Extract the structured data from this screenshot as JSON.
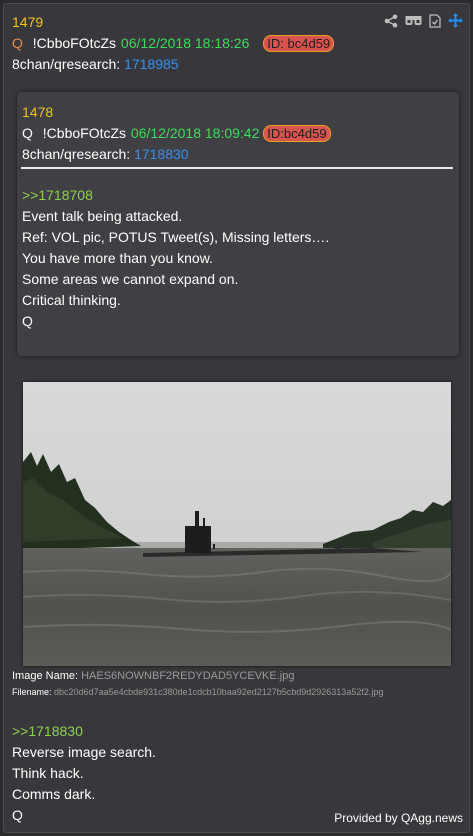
{
  "post": {
    "number": "1479",
    "author": "Q",
    "tripcode": "!CbboFOtcZs",
    "date": "06/12/2018 18:18:26",
    "id": "ID: bc4d59",
    "board": "8chan/qresearch:",
    "thread": "1718985"
  },
  "toolbar": {
    "icons": [
      "share-icon",
      "glasses-icon",
      "document-icon",
      "move-icon"
    ],
    "accent": "#1e90ff"
  },
  "quoted": {
    "number": "1478",
    "author": "Q",
    "tripcode": "!CbboFOtcZs",
    "date": "06/12/2018 18:09:42",
    "id": "ID:bc4d59",
    "board": "8chan/qresearch:",
    "thread": "1718830",
    "reply_link": ">>1718708",
    "lines": [
      "Event talk being attacked.",
      "Ref: VOL pic, POTUS Tweet(s), Missing letters….",
      "You have more than you know.",
      "Some areas we cannot expand on.",
      "Critical thinking.",
      "Q"
    ]
  },
  "image": {
    "name_label": "Image Name:",
    "name": "HAES6NOWNBF2REDYDAD5YCEVKE.jpg",
    "filename_label": "Filename:",
    "filename": "dbc20d6d7aa5e4cbde931c380de1cdcb10baa92ed2127b5cbd9d2926313a52f2.jpg"
  },
  "body": {
    "reply_link": ">>1718830",
    "lines": [
      "Reverse image search.",
      "Think hack.",
      "Comms dark.",
      "Q"
    ]
  },
  "footer": {
    "credit": "Provided by QAgg.news"
  },
  "colors": {
    "background": "#38383c",
    "post_number": "#f0c419",
    "date": "#3ddc5a",
    "link": "#3b8fe8",
    "greentext": "#8fd14f",
    "id_badge": "#d9534f"
  }
}
